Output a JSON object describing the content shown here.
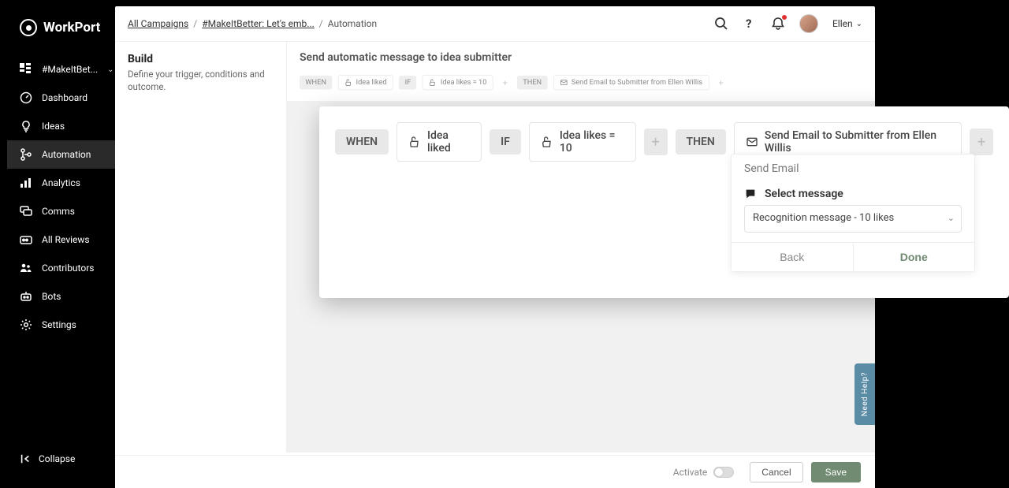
{
  "brand": {
    "name": "WorkPort"
  },
  "sidebar": {
    "items": [
      {
        "label": "#MakeItBet..."
      },
      {
        "label": "Dashboard"
      },
      {
        "label": "Ideas"
      },
      {
        "label": "Automation"
      },
      {
        "label": "Analytics"
      },
      {
        "label": "Comms"
      },
      {
        "label": "All Reviews"
      },
      {
        "label": "Contributors"
      },
      {
        "label": "Bots"
      },
      {
        "label": "Settings"
      }
    ],
    "collapse_label": "Collapse"
  },
  "breadcrumb": {
    "item0": "All Campaigns",
    "item1": "#MakeItBetter: Let's emb...",
    "item2": "Automation"
  },
  "user": {
    "name": "Ellen"
  },
  "build": {
    "title": "Build",
    "subtitle": "Define your trigger, conditions and outcome."
  },
  "canvas": {
    "title": "Send automatic message to idea submitter"
  },
  "rule_small": {
    "when": "WHEN",
    "trigger": "Idea liked",
    "if": "IF",
    "condition": "Idea likes = 10",
    "then": "THEN",
    "action": "Send Email to Submitter from Ellen Willis"
  },
  "rule": {
    "when": "WHEN",
    "trigger": "Idea liked",
    "if": "IF",
    "condition": "Idea likes = 10",
    "then": "THEN",
    "action": "Send Email to Submitter from Ellen Willis"
  },
  "panel": {
    "head": "Send Email",
    "select_label": "Select message",
    "select_value": "Recognition message - 10 likes",
    "back_label": "Back",
    "done_label": "Done"
  },
  "footer": {
    "activate_label": "Activate",
    "cancel_label": "Cancel",
    "save_label": "Save"
  },
  "help": {
    "label": "Need Help?"
  }
}
